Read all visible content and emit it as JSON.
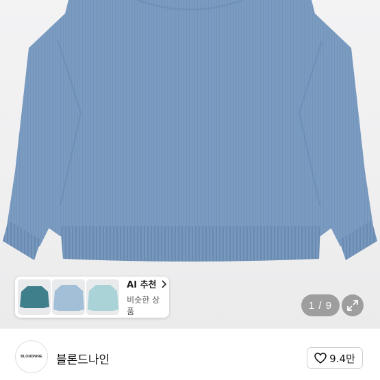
{
  "product_gallery": {
    "page_counter": "1 / 9",
    "current_page": 1,
    "total_pages": 9,
    "expand_icon": "expand-arrows-icon"
  },
  "ai_recommend": {
    "title": "AI 추천",
    "subtitle": "비슷한 상품",
    "chevron_icon": "chevron-right-icon",
    "thumb_colors": [
      "#3f7f8c",
      "#a3bfd8",
      "#a9d3d6"
    ]
  },
  "seller": {
    "logo_text": "BLONDNINE",
    "name": "블론드나인",
    "likes": "9.4만",
    "like_icon": "heart-outline-icon"
  },
  "colors": {
    "sweater": "#7a9cc0",
    "background": "#f0f0f1"
  }
}
